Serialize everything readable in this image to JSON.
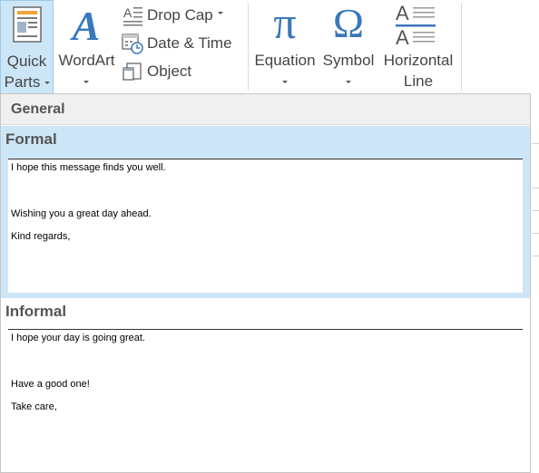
{
  "ribbon": {
    "quick_parts": {
      "line1": "Quick",
      "line2": "Parts"
    },
    "wordart": {
      "label": "WordArt"
    },
    "drop_cap": {
      "label": "Drop Cap"
    },
    "date_time": {
      "label": "Date & Time"
    },
    "object": {
      "label": "Object"
    },
    "equation": {
      "label": "Equation",
      "glyph": "π"
    },
    "symbol": {
      "label": "Symbol",
      "glyph": "Ω"
    },
    "horizontal_line": {
      "line1": "Horizontal",
      "line2": "Line",
      "glyph": "A"
    }
  },
  "gallery": {
    "category": "General",
    "entries": [
      {
        "title": "Formal",
        "lines": [
          "I hope this message finds you well.",
          "Wishing you a great day ahead.",
          "Kind regards,"
        ]
      },
      {
        "title": "Informal",
        "lines": [
          "I hope your day is going great.",
          "Have a good one!",
          "Take care,"
        ]
      }
    ]
  },
  "colors": {
    "accent_blue": "#3a78bb",
    "selected_bg": "#cde6f7",
    "header_bg": "#f0f0f0"
  },
  "icons": [
    "quick-parts-icon",
    "wordart-icon",
    "drop-cap-icon",
    "date-time-icon",
    "object-icon",
    "equation-icon",
    "symbol-icon",
    "horizontal-line-icon"
  ]
}
